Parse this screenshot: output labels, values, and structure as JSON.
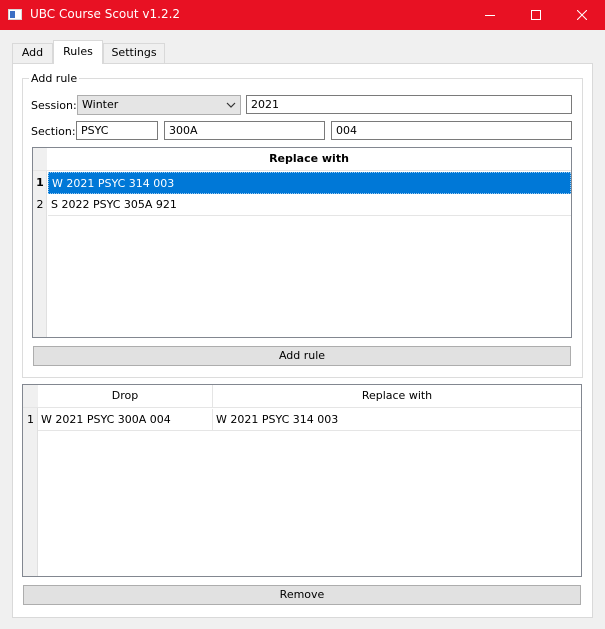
{
  "window": {
    "title": "UBC Course Scout v1.2.2",
    "accent_color": "#e81123",
    "controls": [
      "minimize-icon",
      "maximize-icon",
      "close-icon"
    ]
  },
  "tabs": [
    {
      "label": "Add",
      "active": false
    },
    {
      "label": "Rules",
      "active": true
    },
    {
      "label": "Settings",
      "active": false
    }
  ],
  "add_rule": {
    "group_title": "Add rule",
    "session_label": "Session:",
    "session_value": "Winter",
    "year_value": "2021",
    "section_label": "Section:",
    "subject_value": "PSYC",
    "course_value": "300A",
    "section_value": "004",
    "replace_table": {
      "header": "Replace with",
      "rows": [
        {
          "num": "1",
          "value": "W 2021 PSYC 314 003",
          "selected": true
        },
        {
          "num": "2",
          "value": "S 2022 PSYC 305A 921",
          "selected": false
        }
      ]
    },
    "add_button": "Add rule"
  },
  "rules_table": {
    "headers": [
      "Drop",
      "Replace with"
    ],
    "rows": [
      {
        "num": "1",
        "drop": "W 2021 PSYC 300A 004",
        "replace": "W 2021 PSYC 314 003"
      }
    ]
  },
  "remove_button": "Remove",
  "colors": {
    "selection": "#0078d7"
  }
}
